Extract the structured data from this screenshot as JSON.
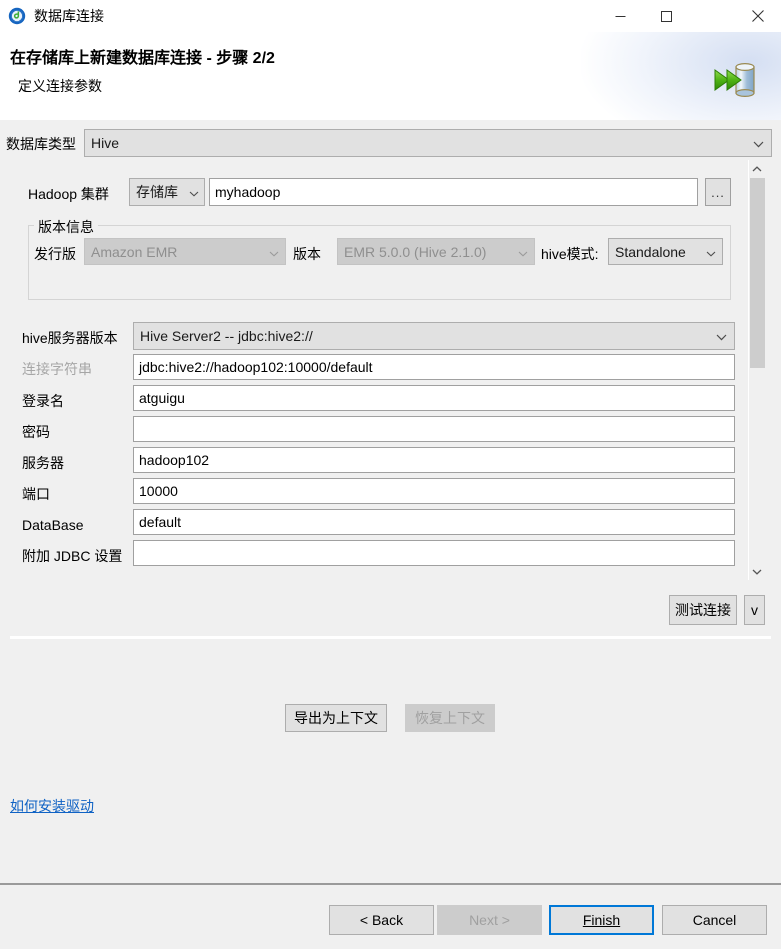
{
  "window": {
    "title": "数据库连接",
    "icon": "database-connection-icon",
    "controls": {
      "minimize": "minimize-icon",
      "maximize": "maximize-icon",
      "close": "close-icon"
    }
  },
  "banner": {
    "title": "在存储库上新建数据库连接 - 步骤 2/2",
    "subtitle": "定义连接参数",
    "icon": "database-import-icon"
  },
  "form": {
    "db_type": {
      "label": "数据库类型",
      "value": "Hive"
    },
    "hadoop_cluster": {
      "label": "Hadoop 集群",
      "source_value": "存储库",
      "name_value": "myhadoop",
      "browse_label": "..."
    },
    "version_group": {
      "legend": "版本信息",
      "distribution_label": "发行版",
      "distribution_value": "Amazon EMR",
      "version_label": "版本",
      "version_value": "EMR 5.0.0 (Hive 2.1.0)",
      "hive_mode_label": "hive模式:",
      "hive_mode_value": "Standalone"
    },
    "fields": [
      {
        "label": "hive服务器版本",
        "value": "Hive Server2 -- jdbc:hive2://",
        "type": "combo",
        "disabled": false
      },
      {
        "label": "连接字符串",
        "value": "jdbc:hive2://hadoop102:10000/default",
        "type": "text",
        "label_disabled": true
      },
      {
        "label": "登录名",
        "value": "atguigu",
        "type": "text"
      },
      {
        "label": "密码",
        "value": "",
        "type": "text"
      },
      {
        "label": "服务器",
        "value": "hadoop102",
        "type": "text"
      },
      {
        "label": "端口",
        "value": "10000",
        "type": "text"
      },
      {
        "label": "DataBase",
        "value": "default",
        "type": "text"
      },
      {
        "label": "附加 JDBC 设置",
        "value": "",
        "type": "text"
      }
    ],
    "test_connection": {
      "label": "测试连接",
      "dropdown_label": "v"
    }
  },
  "context": {
    "export_label": "导出为上下文",
    "revert_label": "恢复上下文"
  },
  "help_link": {
    "label": "如何安装驱动"
  },
  "footer": {
    "back": "< Back",
    "next": "Next >",
    "finish": "Finish",
    "cancel": "Cancel"
  },
  "colors": {
    "accent": "#0078d7",
    "link": "#0f62c4",
    "window_bg": "#f0f0f0",
    "field_bg": "#ffffff",
    "control_bg": "#e1e1e1",
    "disabled_bg": "#cccccc",
    "disabled_text": "#a0a0a0"
  }
}
